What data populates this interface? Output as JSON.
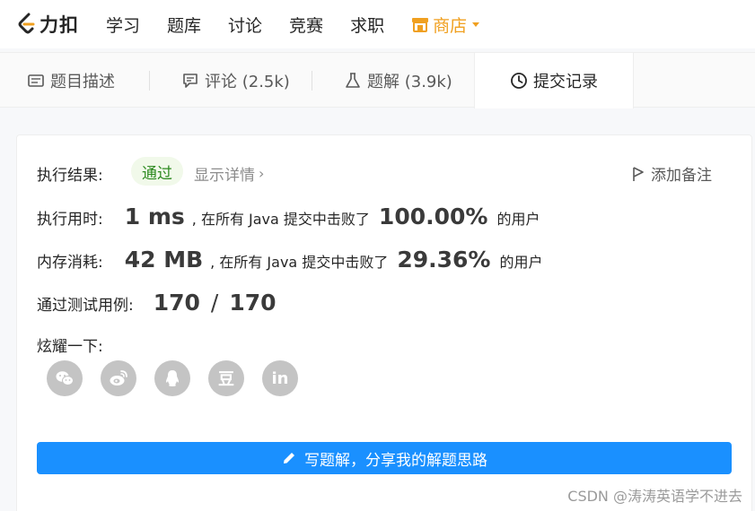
{
  "nav": {
    "logo_text": "力扣",
    "items": [
      "学习",
      "题库",
      "讨论",
      "竞赛",
      "求职"
    ],
    "store_label": "商店",
    "accent": "#f0a020"
  },
  "tabs": {
    "description": "题目描述",
    "comments": "评论 (2.5k)",
    "solutions": "题解 (3.9k)",
    "submissions": "提交记录"
  },
  "result": {
    "status_label": "执行结果:",
    "status_value": "通过",
    "details_link": "显示详情",
    "add_note": "添加备注",
    "runtime_label": "执行用时:",
    "runtime_value": "1 ms",
    "runtime_text": ", 在所有 Java 提交中击败了",
    "runtime_percent": "100.00%",
    "runtime_suffix": "的用户",
    "memory_label": "内存消耗:",
    "memory_value": "42 MB",
    "memory_text": ", 在所有 Java 提交中击败了",
    "memory_percent": "29.36%",
    "memory_suffix": "的用户",
    "testcases_label": "通过测试用例:",
    "testcases_passed": "170",
    "testcases_sep": "/",
    "testcases_total": "170",
    "share_label": "炫耀一下:",
    "share_icons": [
      "wechat-icon",
      "weibo-icon",
      "qq-icon",
      "douban-icon",
      "linkedin-icon"
    ],
    "douban_glyph": "豆",
    "linkedin_glyph": "in",
    "write_button": "写题解，分享我的解题思路"
  },
  "watermark": "CSDN @涛涛英语学不进去"
}
